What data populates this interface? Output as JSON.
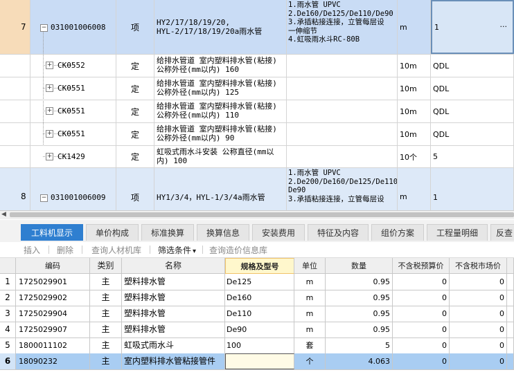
{
  "upper": {
    "row7": {
      "num": "7",
      "code": "031001006008",
      "type": "项",
      "name_lines": [
        "HY2/17/18/19/20,",
        "HYL-2/17/18/19/20a雨水管"
      ],
      "features": [
        "1.雨水管 UPVC",
        "2.De160/De125/De110/De90",
        "3.承插粘接连接，立管每层设",
        "一伸缩节",
        "4.虹吸雨水斗RC-80B"
      ],
      "unit": "m",
      "qty": "1",
      "more": "···"
    },
    "subrows": [
      {
        "code": "CK0552",
        "type": "定",
        "name": "给排水管道 室内塑料排水管(粘接) 公称外径(mm以内) 160",
        "unit": "10m",
        "qty": "QDL"
      },
      {
        "code": "CK0551",
        "type": "定",
        "name": "给排水管道 室内塑料排水管(粘接) 公称外径(mm以内) 125",
        "unit": "10m",
        "qty": "QDL"
      },
      {
        "code": "CK0551",
        "type": "定",
        "name": "给排水管道 室内塑料排水管(粘接) 公称外径(mm以内) 110",
        "unit": "10m",
        "qty": "QDL"
      },
      {
        "code": "CK0551",
        "type": "定",
        "name": "给排水管道 室内塑料排水管(粘接) 公称外径(mm以内) 90",
        "unit": "10m",
        "qty": "QDL"
      },
      {
        "code": "CK1429",
        "type": "定",
        "name": "虹吸式雨水斗安装 公称直径(mm以内) 100",
        "unit": "10个",
        "qty": "5"
      }
    ],
    "row8": {
      "num": "8",
      "code": "031001006009",
      "type": "项",
      "name": "HY1/3/4，HYL-1/3/4a雨水管",
      "features": [
        "1.雨水管 UPVC",
        "2.De200/De160/De125/De110/",
        "De90",
        "3.承插粘接连接，立管每层设"
      ],
      "unit": "m",
      "qty": "1"
    }
  },
  "tabs": [
    "工料机显示",
    "单价构成",
    "标准换算",
    "换算信息",
    "安装费用",
    "特征及内容",
    "组价方案",
    "工程量明细",
    "反查"
  ],
  "toolbar": {
    "insert": "插入",
    "delete": "删除",
    "query_material": "查询人材机库",
    "filter": "筛选条件",
    "filter_arrow": "▾",
    "query_price": "查询造价信息库"
  },
  "lower": {
    "headers": [
      "编码",
      "类别",
      "名称",
      "规格及型号",
      "单位",
      "数量",
      "不含税预算价",
      "不含税市场价"
    ],
    "rows": [
      {
        "n": "1",
        "code": "1725029901",
        "cat": "主",
        "name": "塑料排水管",
        "spec": "De125",
        "unit": "m",
        "qty": "0.95",
        "budget": "0",
        "market": "0"
      },
      {
        "n": "2",
        "code": "1725029902",
        "cat": "主",
        "name": "塑料排水管",
        "spec": "De160",
        "unit": "m",
        "qty": "0.95",
        "budget": "0",
        "market": "0"
      },
      {
        "n": "3",
        "code": "1725029904",
        "cat": "主",
        "name": "塑料排水管",
        "spec": "De110",
        "unit": "m",
        "qty": "0.95",
        "budget": "0",
        "market": "0"
      },
      {
        "n": "4",
        "code": "1725029907",
        "cat": "主",
        "name": "塑料排水管",
        "spec": "De90",
        "unit": "m",
        "qty": "0.95",
        "budget": "0",
        "market": "0"
      },
      {
        "n": "5",
        "code": "1800011102",
        "cat": "主",
        "name": "虹吸式雨水斗",
        "spec": "100",
        "unit": "套",
        "qty": "5",
        "budget": "0",
        "market": "0"
      },
      {
        "n": "6",
        "code": "18090232",
        "cat": "主",
        "name": "室内塑料排水管粘接管件",
        "spec": "",
        "unit": "个",
        "qty": "4.063",
        "budget": "0",
        "market": "0"
      }
    ]
  },
  "colors": {
    "accent": "#2f7fd0",
    "selected_row": "#c9dcf5",
    "current_row": "#a9cdf2",
    "header_highlight": "#fff7cc"
  }
}
